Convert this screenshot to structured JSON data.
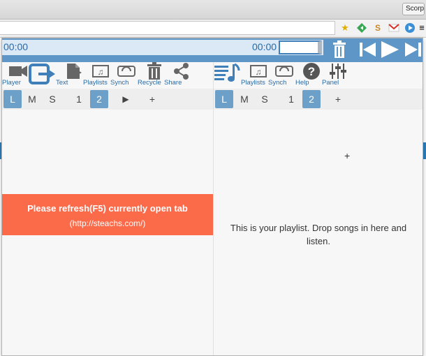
{
  "browser": {
    "tab_label": "Scorpi",
    "extensions": [
      "star-icon",
      "extension-green-icon",
      "extension-s-icon",
      "gmail-icon",
      "play-extension-icon",
      "menu-icon"
    ],
    "colors": {
      "accent": "#5e97c7"
    }
  },
  "player": {
    "time_current": "00:00",
    "time_total": "00:00",
    "controls": [
      "trash-icon",
      "previous-icon",
      "play-icon",
      "next-icon"
    ]
  },
  "left_toolbar": {
    "items": [
      {
        "icon": "video-camera-icon",
        "label": "Player"
      },
      {
        "icon": "exit-icon",
        "label": ""
      },
      {
        "icon": "text-document-icon",
        "label": "Text"
      },
      {
        "icon": "playlists-icon",
        "label": "Playlists"
      },
      {
        "icon": "synch-icon",
        "label": "Synch"
      },
      {
        "icon": "recycle-icon",
        "label": "Recycle"
      },
      {
        "icon": "share-icon",
        "label": "Share"
      }
    ]
  },
  "right_toolbar": {
    "items": [
      {
        "icon": "music-list-icon",
        "label": ""
      },
      {
        "icon": "playlists-icon",
        "label": "Playlists"
      },
      {
        "icon": "synch-icon",
        "label": "Synch"
      },
      {
        "icon": "help-icon",
        "label": "Help"
      },
      {
        "icon": "panel-sliders-icon",
        "label": "Panel"
      }
    ]
  },
  "left_tabs": [
    "L",
    "M",
    "S",
    "1",
    "2",
    "▶",
    "+"
  ],
  "right_tabs": [
    "L",
    "M",
    "S",
    "1",
    "2",
    "+"
  ],
  "notice": {
    "line1": "Please refresh(F5) currently open tab",
    "line2": "(http://steachs.com/)",
    "color": "#fb6a49"
  },
  "playlist_message": "This is your playlist. Drop songs in here and listen.",
  "crosshair": "+"
}
